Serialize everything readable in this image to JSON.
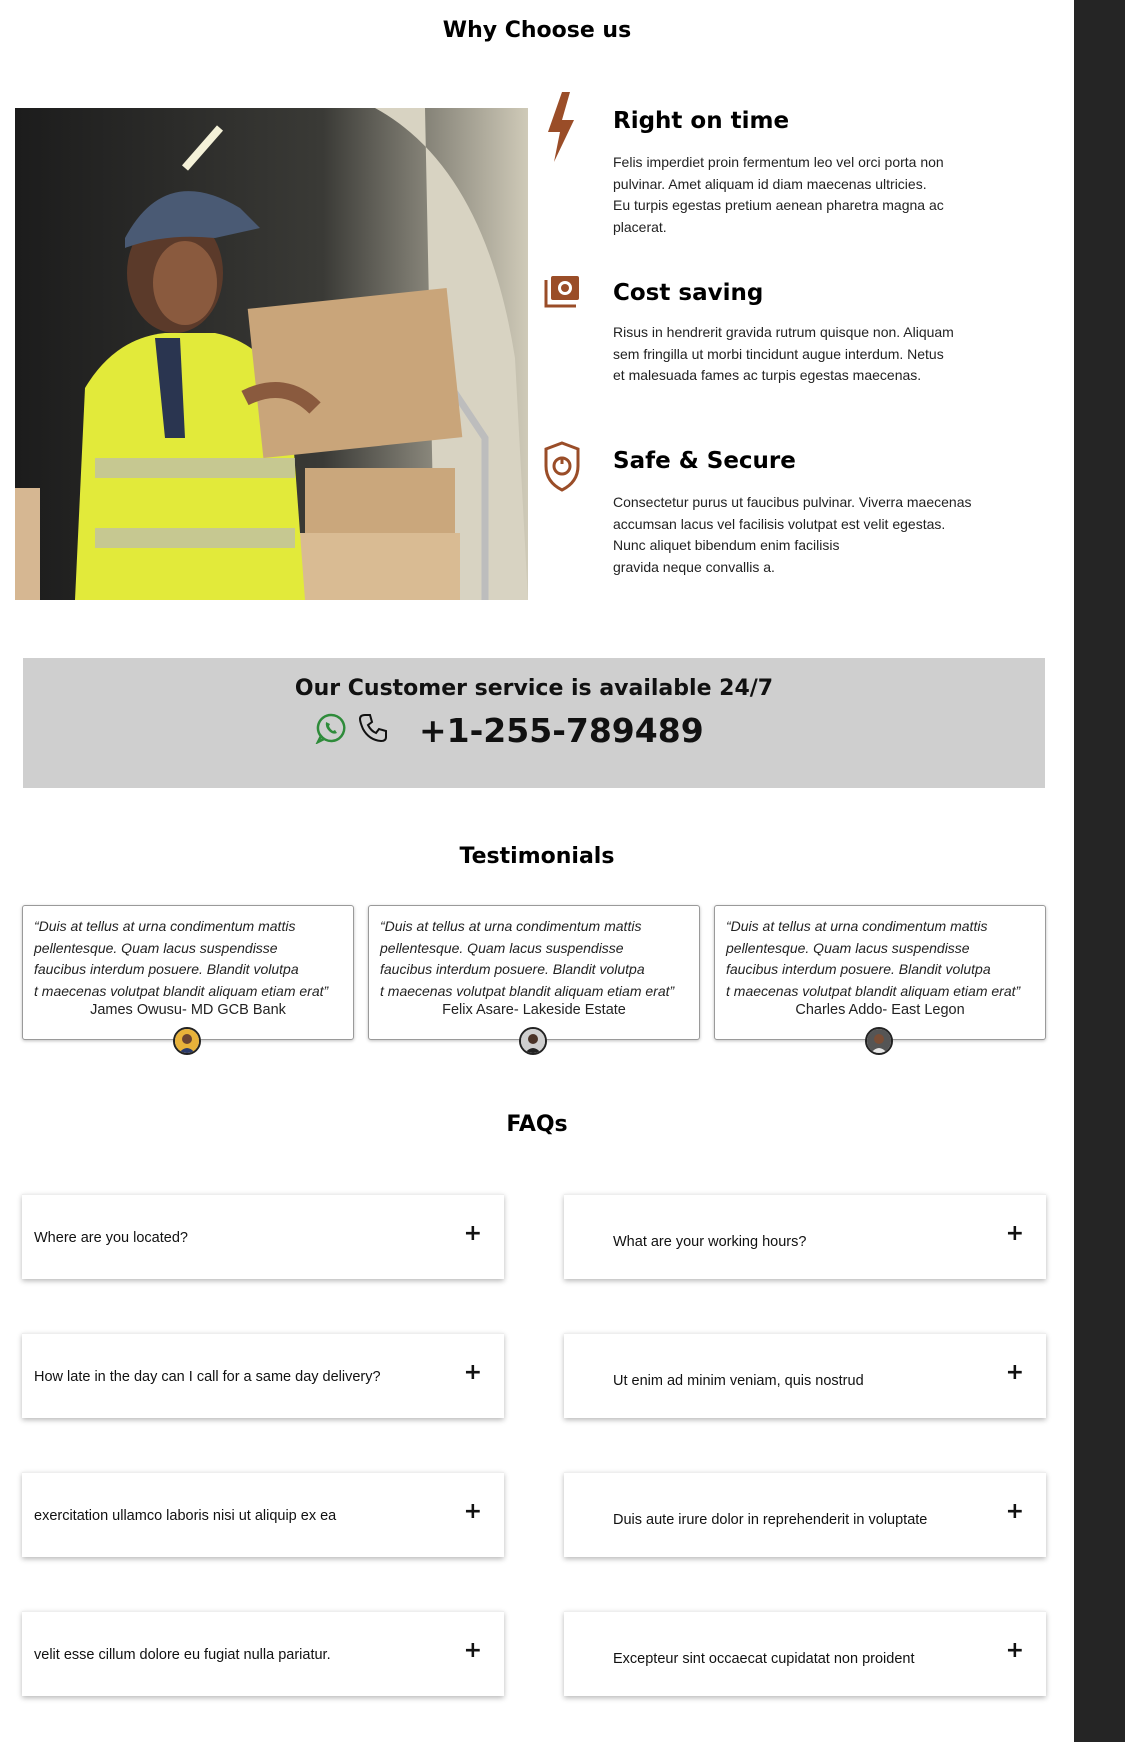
{
  "why": {
    "title": "Why Choose us",
    "features": [
      {
        "icon": "lightning-bolt-icon",
        "title": "Right on time",
        "text": "Felis imperdiet proin fermentum leo vel orci porta non\npulvinar. Amet aliquam id diam maecenas ultricies.\nEu turpis egestas pretium aenean pharetra magna ac\nplacerat."
      },
      {
        "icon": "money-icon",
        "title": "Cost saving",
        "text": "Risus in hendrerit gravida rutrum quisque non. Aliquam\nsem fringilla ut morbi tincidunt augue interdum. Netus\net malesuada fames ac turpis egestas maecenas."
      },
      {
        "icon": "shield-icon",
        "title": "Safe & Secure",
        "text": "Consectetur purus ut faucibus pulvinar. Viverra maecenas\naccumsan lacus vel facilisis volutpat est velit egestas.\nNunc aliquet bibendum enim facilisis\ngravida neque convallis a."
      }
    ],
    "accent_color": "#9a4d28"
  },
  "service": {
    "title": "Our Customer service is available 24/7",
    "phone": "+1-255-789489",
    "whatsapp_color": "#2e8b3a"
  },
  "testimonials": {
    "title": "Testimonials",
    "items": [
      {
        "quote": "“Duis at tellus at urna condimentum mattis\npellentesque. Quam lacus suspendisse\nfaucibus interdum posuere. Blandit volutpa\nt maecenas volutpat blandit aliquam etiam erat”",
        "author": "James Owusu- MD GCB Bank"
      },
      {
        "quote": "“Duis at tellus at urna condimentum mattis\npellentesque. Quam lacus suspendisse\nfaucibus interdum posuere. Blandit volutpa\nt maecenas volutpat blandit aliquam etiam erat”",
        "author": "Felix Asare-  Lakeside Estate"
      },
      {
        "quote": "“Duis at tellus at urna condimentum mattis\npellentesque. Quam lacus suspendisse\nfaucibus interdum posuere. Blandit volutpa\nt maecenas volutpat blandit aliquam etiam erat”",
        "author": "Charles Addo- East Legon"
      }
    ]
  },
  "faqs": {
    "title": "FAQs",
    "left": [
      "Where are you located?",
      "How late in the day can I call for a same day delivery?",
      "exercitation ullamco laboris nisi ut aliquip ex ea",
      "velit esse cillum dolore eu fugiat nulla pariatur."
    ],
    "right": [
      "What are your working hours?",
      "Ut enim ad minim veniam, quis nostrud",
      "Duis aute irure dolor in reprehenderit in voluptate",
      "Excepteur sint occaecat cupidatat non proident"
    ],
    "expand_symbol": "+"
  }
}
